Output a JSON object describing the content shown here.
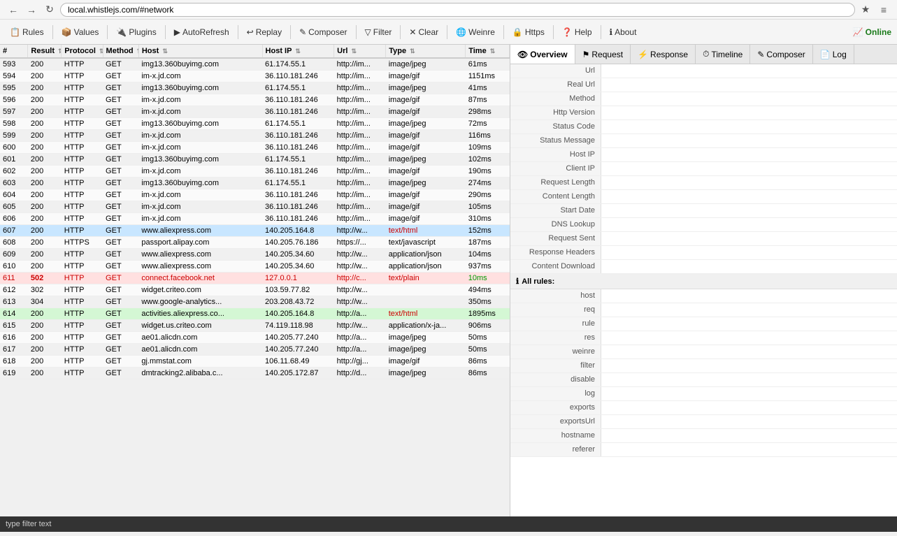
{
  "browser": {
    "url": "local.whistlejs.com/#network",
    "back_label": "←",
    "forward_label": "→",
    "reload_label": "↻",
    "star_label": "☆",
    "menu_label": "≡"
  },
  "toolbar": {
    "items": [
      {
        "id": "rules",
        "icon": "📋",
        "label": "Rules"
      },
      {
        "id": "values",
        "icon": "📦",
        "label": "Values"
      },
      {
        "id": "plugins",
        "icon": "🔌",
        "label": "Plugins"
      },
      {
        "id": "autorefresh",
        "icon": "▶",
        "label": "AutoRefresh"
      },
      {
        "id": "replay",
        "icon": "↩",
        "label": "Replay"
      },
      {
        "id": "composer",
        "icon": "✎",
        "label": "Composer"
      },
      {
        "id": "filter",
        "icon": "▽",
        "label": "Filter"
      },
      {
        "id": "clear",
        "icon": "✕",
        "label": "Clear"
      },
      {
        "id": "weinre",
        "icon": "🌐",
        "label": "Weinre"
      },
      {
        "id": "https",
        "icon": "🔒",
        "label": "Https"
      },
      {
        "id": "help",
        "icon": "❓",
        "label": "Help"
      },
      {
        "id": "about",
        "icon": "ℹ",
        "label": "About"
      }
    ],
    "online_label": "Online"
  },
  "table": {
    "columns": [
      {
        "id": "num",
        "label": "#"
      },
      {
        "id": "result",
        "label": "Result"
      },
      {
        "id": "protocol",
        "label": "Protocol"
      },
      {
        "id": "method",
        "label": "Method"
      },
      {
        "id": "host",
        "label": "Host"
      },
      {
        "id": "hostip",
        "label": "Host IP"
      },
      {
        "id": "url",
        "label": "Url"
      },
      {
        "id": "type",
        "label": "Type"
      },
      {
        "id": "time",
        "label": "Time"
      }
    ],
    "rows": [
      {
        "num": "593",
        "result": "200",
        "protocol": "HTTP",
        "method": "GET",
        "host": "img13.360buyimg.com",
        "hostip": "61.174.55.1",
        "url": "http://im...",
        "type": "image/jpeg",
        "time": "61ms",
        "highlight": ""
      },
      {
        "num": "594",
        "result": "200",
        "protocol": "HTTP",
        "method": "GET",
        "host": "im-x.jd.com",
        "hostip": "36.110.181.246",
        "url": "http://im...",
        "type": "image/gif",
        "time": "1151ms",
        "highlight": ""
      },
      {
        "num": "595",
        "result": "200",
        "protocol": "HTTP",
        "method": "GET",
        "host": "img13.360buyimg.com",
        "hostip": "61.174.55.1",
        "url": "http://im...",
        "type": "image/jpeg",
        "time": "41ms",
        "highlight": ""
      },
      {
        "num": "596",
        "result": "200",
        "protocol": "HTTP",
        "method": "GET",
        "host": "im-x.jd.com",
        "hostip": "36.110.181.246",
        "url": "http://im...",
        "type": "image/gif",
        "time": "87ms",
        "highlight": ""
      },
      {
        "num": "597",
        "result": "200",
        "protocol": "HTTP",
        "method": "GET",
        "host": "im-x.jd.com",
        "hostip": "36.110.181.246",
        "url": "http://im...",
        "type": "image/gif",
        "time": "298ms",
        "highlight": ""
      },
      {
        "num": "598",
        "result": "200",
        "protocol": "HTTP",
        "method": "GET",
        "host": "img13.360buyimg.com",
        "hostip": "61.174.55.1",
        "url": "http://im...",
        "type": "image/jpeg",
        "time": "72ms",
        "highlight": ""
      },
      {
        "num": "599",
        "result": "200",
        "protocol": "HTTP",
        "method": "GET",
        "host": "im-x.jd.com",
        "hostip": "36.110.181.246",
        "url": "http://im...",
        "type": "image/gif",
        "time": "116ms",
        "highlight": ""
      },
      {
        "num": "600",
        "result": "200",
        "protocol": "HTTP",
        "method": "GET",
        "host": "im-x.jd.com",
        "hostip": "36.110.181.246",
        "url": "http://im...",
        "type": "image/gif",
        "time": "109ms",
        "highlight": ""
      },
      {
        "num": "601",
        "result": "200",
        "protocol": "HTTP",
        "method": "GET",
        "host": "img13.360buyimg.com",
        "hostip": "61.174.55.1",
        "url": "http://im...",
        "type": "image/jpeg",
        "time": "102ms",
        "highlight": ""
      },
      {
        "num": "602",
        "result": "200",
        "protocol": "HTTP",
        "method": "GET",
        "host": "im-x.jd.com",
        "hostip": "36.110.181.246",
        "url": "http://im...",
        "type": "image/gif",
        "time": "190ms",
        "highlight": ""
      },
      {
        "num": "603",
        "result": "200",
        "protocol": "HTTP",
        "method": "GET",
        "host": "img13.360buyimg.com",
        "hostip": "61.174.55.1",
        "url": "http://im...",
        "type": "image/jpeg",
        "time": "274ms",
        "highlight": ""
      },
      {
        "num": "604",
        "result": "200",
        "protocol": "HTTP",
        "method": "GET",
        "host": "im-x.jd.com",
        "hostip": "36.110.181.246",
        "url": "http://im...",
        "type": "image/gif",
        "time": "290ms",
        "highlight": ""
      },
      {
        "num": "605",
        "result": "200",
        "protocol": "HTTP",
        "method": "GET",
        "host": "im-x.jd.com",
        "hostip": "36.110.181.246",
        "url": "http://im...",
        "type": "image/gif",
        "time": "105ms",
        "highlight": ""
      },
      {
        "num": "606",
        "result": "200",
        "protocol": "HTTP",
        "method": "GET",
        "host": "im-x.jd.com",
        "hostip": "36.110.181.246",
        "url": "http://im...",
        "type": "image/gif",
        "time": "310ms",
        "highlight": ""
      },
      {
        "num": "607",
        "result": "200",
        "protocol": "HTTP",
        "method": "GET",
        "host": "www.aliexpress.com",
        "hostip": "140.205.164.8",
        "url": "http://w...",
        "type": "text/html",
        "time": "152ms",
        "highlight": "blue"
      },
      {
        "num": "608",
        "result": "200",
        "protocol": "HTTPS",
        "method": "GET",
        "host": "passport.alipay.com",
        "hostip": "140.205.76.186",
        "url": "https://...",
        "type": "text/javascript",
        "time": "187ms",
        "highlight": ""
      },
      {
        "num": "609",
        "result": "200",
        "protocol": "HTTP",
        "method": "GET",
        "host": "www.aliexpress.com",
        "hostip": "140.205.34.60",
        "url": "http://w...",
        "type": "application/json",
        "time": "104ms",
        "highlight": ""
      },
      {
        "num": "610",
        "result": "200",
        "protocol": "HTTP",
        "method": "GET",
        "host": "www.aliexpress.com",
        "hostip": "140.205.34.60",
        "url": "http://w...",
        "type": "application/json",
        "time": "937ms",
        "highlight": ""
      },
      {
        "num": "611",
        "result": "502",
        "protocol": "HTTP",
        "method": "GET",
        "host": "connect.facebook.net",
        "hostip": "127.0.0.1",
        "url": "http://c...",
        "type": "text/plain",
        "time": "10ms",
        "highlight": "red"
      },
      {
        "num": "612",
        "result": "302",
        "protocol": "HTTP",
        "method": "GET",
        "host": "widget.criteo.com",
        "hostip": "103.59.77.82",
        "url": "http://w...",
        "type": "",
        "time": "494ms",
        "highlight": ""
      },
      {
        "num": "613",
        "result": "304",
        "protocol": "HTTP",
        "method": "GET",
        "host": "www.google-analytics...",
        "hostip": "203.208.43.72",
        "url": "http://w...",
        "type": "",
        "time": "350ms",
        "highlight": ""
      },
      {
        "num": "614",
        "result": "200",
        "protocol": "HTTP",
        "method": "GET",
        "host": "activities.aliexpress.co...",
        "hostip": "140.205.164.8",
        "url": "http://a...",
        "type": "text/html",
        "time": "1895ms",
        "highlight": "green"
      },
      {
        "num": "615",
        "result": "200",
        "protocol": "HTTP",
        "method": "GET",
        "host": "widget.us.criteo.com",
        "hostip": "74.119.118.98",
        "url": "http://w...",
        "type": "application/x-ja...",
        "time": "906ms",
        "highlight": ""
      },
      {
        "num": "616",
        "result": "200",
        "protocol": "HTTP",
        "method": "GET",
        "host": "ae01.alicdn.com",
        "hostip": "140.205.77.240",
        "url": "http://a...",
        "type": "image/jpeg",
        "time": "50ms",
        "highlight": ""
      },
      {
        "num": "617",
        "result": "200",
        "protocol": "HTTP",
        "method": "GET",
        "host": "ae01.alicdn.com",
        "hostip": "140.205.77.240",
        "url": "http://a...",
        "type": "image/jpeg",
        "time": "50ms",
        "highlight": ""
      },
      {
        "num": "618",
        "result": "200",
        "protocol": "HTTP",
        "method": "GET",
        "host": "gj.mmstat.com",
        "hostip": "106.11.68.49",
        "url": "http://gj...",
        "type": "image/gif",
        "time": "86ms",
        "highlight": ""
      },
      {
        "num": "619",
        "result": "200",
        "protocol": "HTTP",
        "method": "GET",
        "host": "dmtracking2.alibaba.c...",
        "hostip": "140.205.172.87",
        "url": "http://d...",
        "type": "image/jpeg",
        "time": "86ms",
        "highlight": ""
      }
    ]
  },
  "right_panel": {
    "tabs": [
      {
        "id": "overview",
        "icon": "👁",
        "label": "Overview",
        "active": true
      },
      {
        "id": "request",
        "icon": "⚑",
        "label": "Request",
        "active": false
      },
      {
        "id": "response",
        "icon": "⚡",
        "label": "Response",
        "active": false
      },
      {
        "id": "timeline",
        "icon": "⏱",
        "label": "Timeline",
        "active": false
      },
      {
        "id": "composer",
        "icon": "✎",
        "label": "Composer",
        "active": false
      },
      {
        "id": "log",
        "icon": "📄",
        "label": "Log",
        "active": false
      }
    ],
    "overview": {
      "fields": [
        {
          "label": "Url",
          "value": ""
        },
        {
          "label": "Real Url",
          "value": ""
        },
        {
          "label": "Method",
          "value": ""
        },
        {
          "label": "Http Version",
          "value": ""
        },
        {
          "label": "Status Code",
          "value": ""
        },
        {
          "label": "Status Message",
          "value": ""
        },
        {
          "label": "Host IP",
          "value": ""
        },
        {
          "label": "Client IP",
          "value": ""
        },
        {
          "label": "Request Length",
          "value": ""
        },
        {
          "label": "Content Length",
          "value": ""
        },
        {
          "label": "Start Date",
          "value": ""
        },
        {
          "label": "DNS Lookup",
          "value": ""
        },
        {
          "label": "Request Sent",
          "value": ""
        },
        {
          "label": "Response Headers",
          "value": ""
        },
        {
          "label": "Content Download",
          "value": ""
        }
      ],
      "rules_header": "All rules:",
      "rules": [
        {
          "label": "host",
          "value": ""
        },
        {
          "label": "req",
          "value": ""
        },
        {
          "label": "rule",
          "value": ""
        },
        {
          "label": "res",
          "value": ""
        },
        {
          "label": "weinre",
          "value": ""
        },
        {
          "label": "filter",
          "value": ""
        },
        {
          "label": "disable",
          "value": ""
        },
        {
          "label": "log",
          "value": ""
        },
        {
          "label": "exports",
          "value": ""
        },
        {
          "label": "exportsUrl",
          "value": ""
        },
        {
          "label": "hostname",
          "value": ""
        },
        {
          "label": "referer",
          "value": ""
        }
      ]
    }
  },
  "status_bar": {
    "text": "type filter text"
  }
}
